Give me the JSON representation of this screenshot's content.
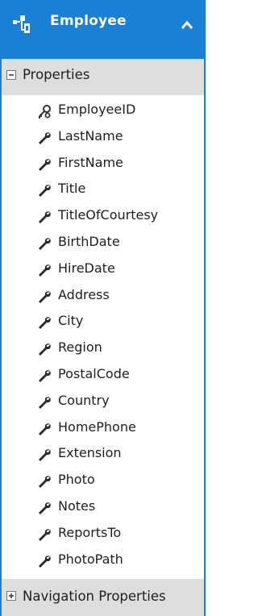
{
  "entity": {
    "title": "Employee",
    "accent_color": "#1a80d6",
    "icon": "entity-type-icon",
    "collapse_icon": "chevron-up-icon"
  },
  "properties_section": {
    "label": "Properties",
    "expander": "minus-icon",
    "items": [
      {
        "label": "EmployeeID",
        "icon": "key-icon"
      },
      {
        "label": "LastName",
        "icon": "wrench-icon"
      },
      {
        "label": "FirstName",
        "icon": "wrench-icon"
      },
      {
        "label": "Title",
        "icon": "wrench-icon"
      },
      {
        "label": "TitleOfCourtesy",
        "icon": "wrench-icon"
      },
      {
        "label": "BirthDate",
        "icon": "wrench-icon"
      },
      {
        "label": "HireDate",
        "icon": "wrench-icon"
      },
      {
        "label": "Address",
        "icon": "wrench-icon"
      },
      {
        "label": "City",
        "icon": "wrench-icon"
      },
      {
        "label": "Region",
        "icon": "wrench-icon"
      },
      {
        "label": "PostalCode",
        "icon": "wrench-icon"
      },
      {
        "label": "Country",
        "icon": "wrench-icon"
      },
      {
        "label": "HomePhone",
        "icon": "wrench-icon"
      },
      {
        "label": "Extension",
        "icon": "wrench-icon"
      },
      {
        "label": "Photo",
        "icon": "wrench-icon"
      },
      {
        "label": "Notes",
        "icon": "wrench-icon"
      },
      {
        "label": "ReportsTo",
        "icon": "wrench-icon"
      },
      {
        "label": "PhotoPath",
        "icon": "wrench-icon"
      }
    ]
  },
  "navigation_section": {
    "label": "Navigation Properties",
    "expander": "plus-icon"
  }
}
